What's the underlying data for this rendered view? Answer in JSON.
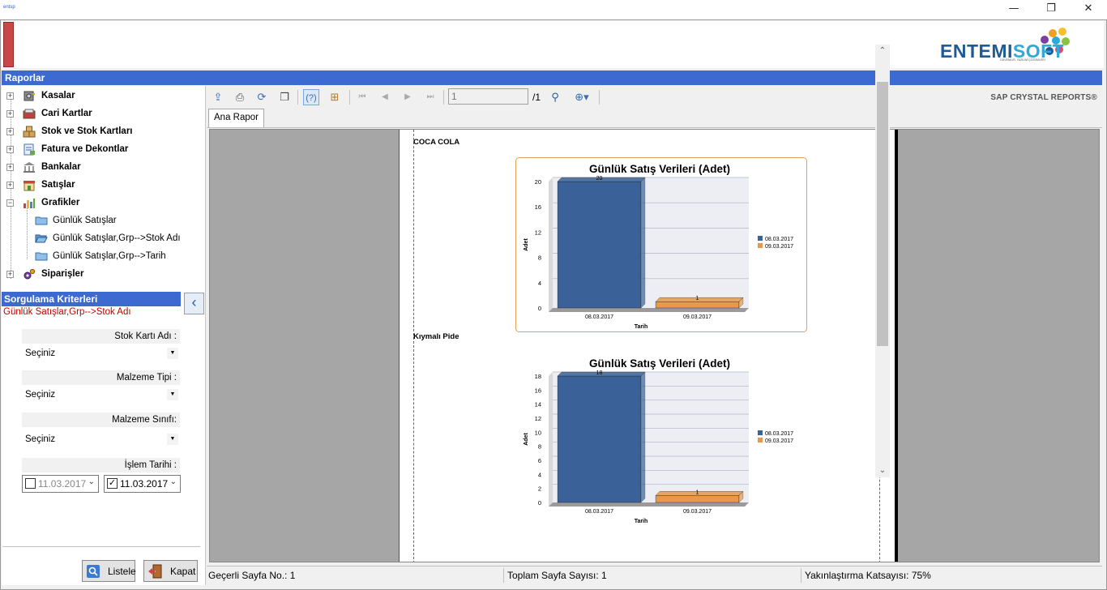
{
  "window": {
    "min": "—",
    "max": "❐",
    "close": "✕"
  },
  "brand": {
    "logo_part1": "ENTEMI",
    "logo_part2": "SOFT",
    "logo_tagline": "GÜVENİLİR, YAZILIM ÇÖZÜMLERİ"
  },
  "sections": {
    "raporlar": "Raporlar"
  },
  "tree": {
    "items": [
      {
        "label": "Kasalar",
        "exp": "+"
      },
      {
        "label": "Cari Kartlar",
        "exp": "+"
      },
      {
        "label": "Stok ve Stok Kartları",
        "exp": "+"
      },
      {
        "label": "Fatura ve Dekontlar",
        "exp": "+"
      },
      {
        "label": "Bankalar",
        "exp": "+"
      },
      {
        "label": "Satışlar",
        "exp": "+"
      },
      {
        "label": "Grafikler",
        "exp": "−"
      },
      {
        "label": "Siparişler",
        "exp": "+"
      }
    ],
    "sub": [
      {
        "label": "Günlük Satışlar"
      },
      {
        "label": "Günlük Satışlar,Grp-->Stok Adı"
      },
      {
        "label": "Günlük Satışlar,Grp-->Tarih"
      }
    ]
  },
  "criteria": {
    "title": "Sorgulama Kriterleri",
    "selected_report": "Günlük Satışlar,Grp-->Stok Adı",
    "fields": [
      {
        "label": "Stok Kartı Adı :",
        "value": "Seçiniz"
      },
      {
        "label": "Malzeme Tipi :",
        "value": "Seçiniz"
      },
      {
        "label": "Malzeme Sınıfı:",
        "value": "Seçiniz"
      }
    ],
    "date_label": "İşlem Tarihi :",
    "date_start": {
      "value": "11.03.2017",
      "checked": false
    },
    "date_end": {
      "value": "11.03.2017",
      "checked": true
    },
    "btn_list": "Listele",
    "btn_close": "Kapat"
  },
  "viewer": {
    "page_input": "1",
    "page_total": "/1",
    "brand": "SAP CRYSTAL REPORTS®",
    "tab": "Ana Rapor",
    "status_current": "Geçerli Sayfa No.: 1",
    "status_total": "Toplam Sayfa Sayısı: 1",
    "status_zoom": "Yakınlaştırma Katsayısı: 75%"
  },
  "report": {
    "groups": [
      {
        "title": "COCA COLA"
      },
      {
        "title": "Kıymalı Pide"
      }
    ]
  },
  "colors": {
    "series1": "#3a6298",
    "series2": "#e49a4a"
  },
  "chart_data": [
    {
      "type": "bar",
      "title": "Günlük Satış Verileri  (Adet)",
      "xlabel": "Tarih",
      "ylabel": "Adet",
      "categories": [
        "08.03.2017",
        "09.03.2017"
      ],
      "values": [
        20,
        1
      ],
      "data_labels": [
        "20",
        "1"
      ],
      "legend": [
        "08.03.2017",
        "09.03.2017"
      ],
      "legend_position": "right",
      "yticks": [
        0,
        4,
        8,
        12,
        16,
        20
      ],
      "ylim": [
        0,
        20
      ],
      "grid": true
    },
    {
      "type": "bar",
      "title": "Günlük Satış Verileri  (Adet)",
      "xlabel": "Tarih",
      "ylabel": "Adet",
      "categories": [
        "08.03.2017",
        "09.03.2017"
      ],
      "values": [
        18,
        1
      ],
      "data_labels": [
        "18",
        "1"
      ],
      "legend": [
        "08.03.2017",
        "09.03.2017"
      ],
      "legend_position": "right",
      "yticks": [
        0,
        2,
        4,
        6,
        8,
        10,
        12,
        14,
        16,
        18
      ],
      "ylim": [
        0,
        18
      ],
      "grid": true
    }
  ]
}
